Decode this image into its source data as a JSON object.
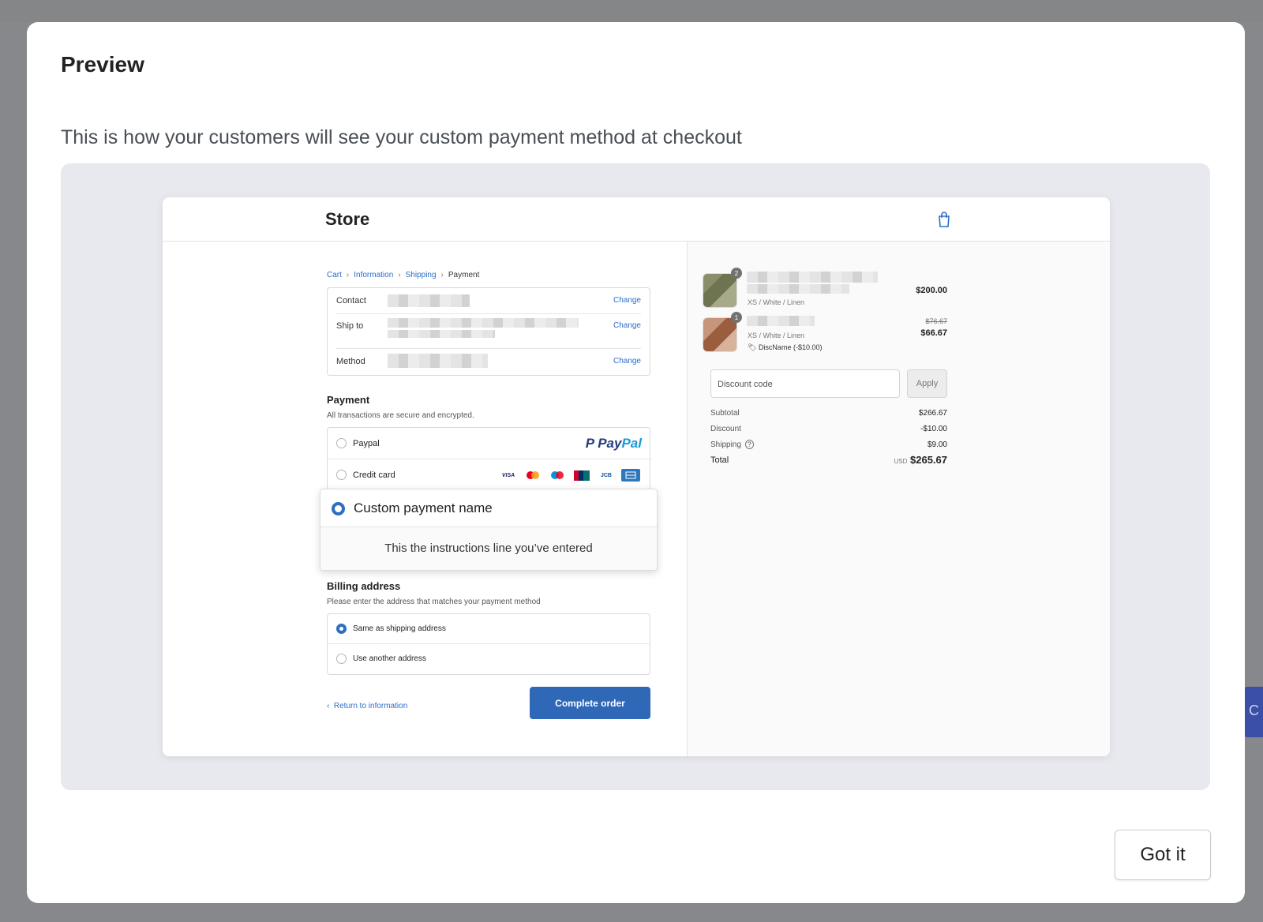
{
  "modal": {
    "title": "Preview",
    "subtitle": "This is how your customers will see your custom payment method at checkout",
    "got_it_label": "Got it"
  },
  "background": {
    "partial_button_label": "C"
  },
  "store": {
    "name": "Store",
    "breadcrumbs": [
      {
        "label": "Cart"
      },
      {
        "label": "Information"
      },
      {
        "label": "Shipping"
      },
      {
        "label": "Payment"
      }
    ],
    "info_rows": [
      {
        "label": "Contact",
        "change": "Change"
      },
      {
        "label": "Ship to",
        "change": "Change"
      },
      {
        "label": "Method",
        "change": "Change"
      }
    ],
    "payment": {
      "heading": "Payment",
      "subheading": "All transactions are secure and encrypted.",
      "options": [
        {
          "label": "Paypal",
          "selected": false,
          "logo": "PayPal"
        },
        {
          "label": "Credit card",
          "selected": false,
          "cards": [
            "VISA",
            "mastercard-icon",
            "maestro-icon",
            "unionpay-icon",
            "JCB",
            "amex-icon"
          ]
        }
      ],
      "custom": {
        "name": "Custom payment name",
        "instructions": "This the instructions line you’ve entered",
        "selected": true
      }
    },
    "billing": {
      "heading": "Billing address",
      "subheading": "Please enter the address that matches your payment method",
      "options": [
        {
          "label": "Same as shipping address",
          "selected": true
        },
        {
          "label": "Use another address",
          "selected": false
        }
      ]
    },
    "return_label": "Return to information",
    "complete_label": "Complete order",
    "summary": {
      "items": [
        {
          "qty": "2",
          "variant": "XS / White / Linen",
          "price": "$200.00"
        },
        {
          "qty": "1",
          "variant": "XS / White / Linen",
          "original_price": "$76.67",
          "price": "$66.67",
          "discount_tag": "DiscName (-$10.00)"
        }
      ],
      "discount_placeholder": "Discount code",
      "apply_label": "Apply",
      "rows": [
        {
          "label": "Subtotal",
          "value": "$266.67"
        },
        {
          "label": "Discount",
          "value": "-$10.00"
        },
        {
          "label": "Shipping",
          "value": "$9.00"
        }
      ],
      "total_label": "Total",
      "currency": "USD",
      "total_value": "$265.67"
    }
  },
  "colors": {
    "accent": "#2c6ecb",
    "button": "#3068b8",
    "paypal_dark": "#253b80",
    "paypal_light": "#179bd7"
  }
}
